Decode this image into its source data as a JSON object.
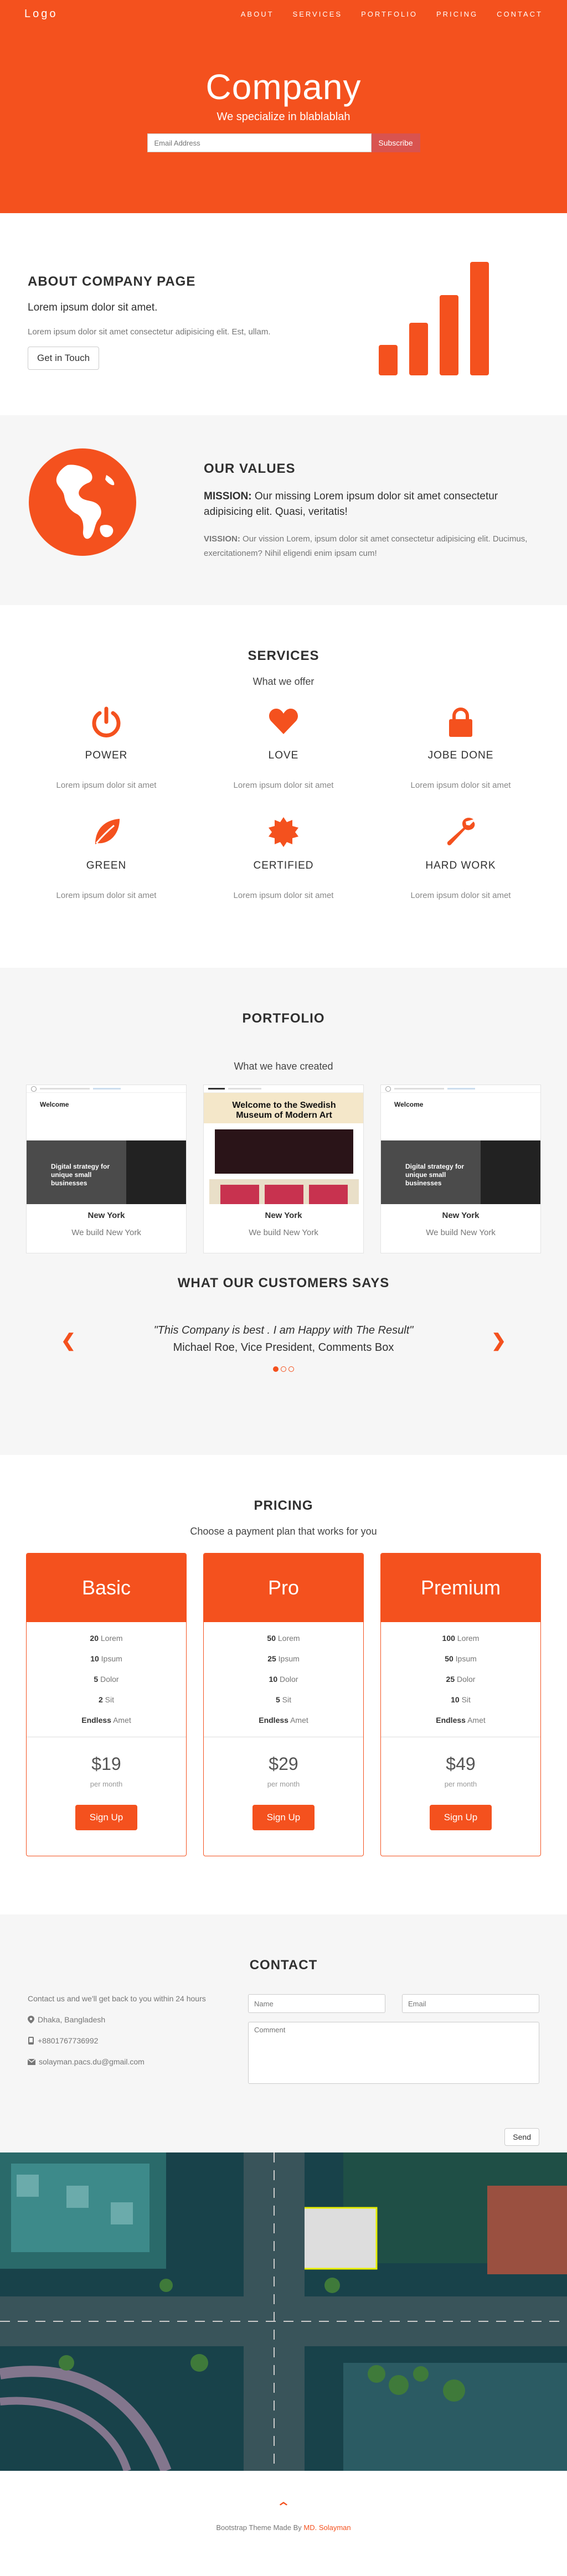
{
  "nav": {
    "logo": "Logo",
    "links": [
      "ABOUT",
      "SERVICES",
      "PORTFOLIO",
      "PRICING",
      "CONTACT"
    ]
  },
  "hero": {
    "title": "Company",
    "tagline": "We specialize in blablablah",
    "email_placeholder": "Email Address",
    "subscribe": "Subscribe"
  },
  "about": {
    "heading": "ABOUT COMPANY PAGE",
    "lead": "Lorem ipsum dolor sit amet.",
    "text": "Lorem ipsum dolor sit amet consectetur adipisicing elit. Est, ullam.",
    "button": "Get in Touch",
    "chart_icon": "bar-chart-icon"
  },
  "values": {
    "heading": "OUR VALUES",
    "mission_label": "MISSION:",
    "mission": "Our missing Lorem ipsum dolor sit amet consectetur adipisicing elit. Quasi, veritatis!",
    "vission_label": "VISSION:",
    "vission": "Our vission Lorem, ipsum dolor sit amet consectetur adipisicing elit. Ducimus, exercitationem? Nihil eligendi enim ipsam cum!",
    "globe_icon": "globe-icon"
  },
  "services": {
    "heading": "SERVICES",
    "sub": "What we offer",
    "items": [
      {
        "title": "POWER",
        "desc": "Lorem ipsum dolor sit amet",
        "icon": "power-icon"
      },
      {
        "title": "LOVE",
        "desc": "Lorem ipsum dolor sit amet",
        "icon": "heart-icon"
      },
      {
        "title": "JOBE DONE",
        "desc": "Lorem ipsum dolor sit amet",
        "icon": "lock-icon"
      },
      {
        "title": "GREEN",
        "desc": "Lorem ipsum dolor sit amet",
        "icon": "leaf-icon"
      },
      {
        "title": "CERTIFIED",
        "desc": "Lorem ipsum dolor sit amet",
        "icon": "certificate-icon"
      },
      {
        "title": "HARD WORK",
        "desc": "Lorem ipsum dolor sit amet",
        "icon": "wrench-icon"
      }
    ]
  },
  "portfolio": {
    "heading": "PORTFOLIO",
    "sub": "What we have created",
    "items": [
      {
        "city": "New York",
        "caption": "We build New York",
        "site_title": "Welcome",
        "banner": "Digital strategy for unique small businesses"
      },
      {
        "city": "New York",
        "caption": "We build New York",
        "site_title": "Welcome to the Swedish Museum of Modern Art"
      },
      {
        "city": "New York",
        "caption": "We build New York",
        "site_title": "Welcome",
        "banner": "Digital strategy for unique small businesses"
      }
    ],
    "customers_heading": "WHAT OUR CUSTOMERS SAYS",
    "quote": "\"This Company is best . I am Happy with The Result\"",
    "author": "Michael Roe, Vice President, Comments Box",
    "prev_icon": "chevron-left-icon",
    "next_icon": "chevron-right-icon"
  },
  "pricing": {
    "heading": "PRICING",
    "sub": "Choose a payment plan that works for you",
    "plans": [
      {
        "name": "Basic",
        "features": [
          [
            "20",
            "Lorem"
          ],
          [
            "10",
            "Ipsum"
          ],
          [
            "5",
            "Dolor"
          ],
          [
            "2",
            "Sit"
          ],
          [
            "Endless",
            "Amet"
          ]
        ],
        "price": "$19",
        "per": "per month",
        "button": "Sign Up"
      },
      {
        "name": "Pro",
        "features": [
          [
            "50",
            "Lorem"
          ],
          [
            "25",
            "Ipsum"
          ],
          [
            "10",
            "Dolor"
          ],
          [
            "5",
            "Sit"
          ],
          [
            "Endless",
            "Amet"
          ]
        ],
        "price": "$29",
        "per": "per month",
        "button": "Sign Up"
      },
      {
        "name": "Premium",
        "features": [
          [
            "100",
            "Lorem"
          ],
          [
            "50",
            "Ipsum"
          ],
          [
            "25",
            "Dolor"
          ],
          [
            "10",
            "Sit"
          ],
          [
            "Endless",
            "Amet"
          ]
        ],
        "price": "$49",
        "per": "per month",
        "button": "Sign Up"
      }
    ]
  },
  "contact": {
    "heading": "CONTACT",
    "intro": "Contact us and we'll get back to you within 24 hours",
    "location": "Dhaka, Bangladesh",
    "phone": "+8801767736992",
    "email": "solayman.pacs.du@gmail.com",
    "name_placeholder": "Name",
    "email_placeholder": "Email",
    "comment_placeholder": "Comment",
    "send": "Send"
  },
  "footer": {
    "up_icon": "chevron-up-icon",
    "credit": "Bootstrap Theme Made By",
    "author": "MD. Solayman"
  },
  "colors": {
    "accent": "#f4511e",
    "section_gray": "#f6f6f6"
  }
}
